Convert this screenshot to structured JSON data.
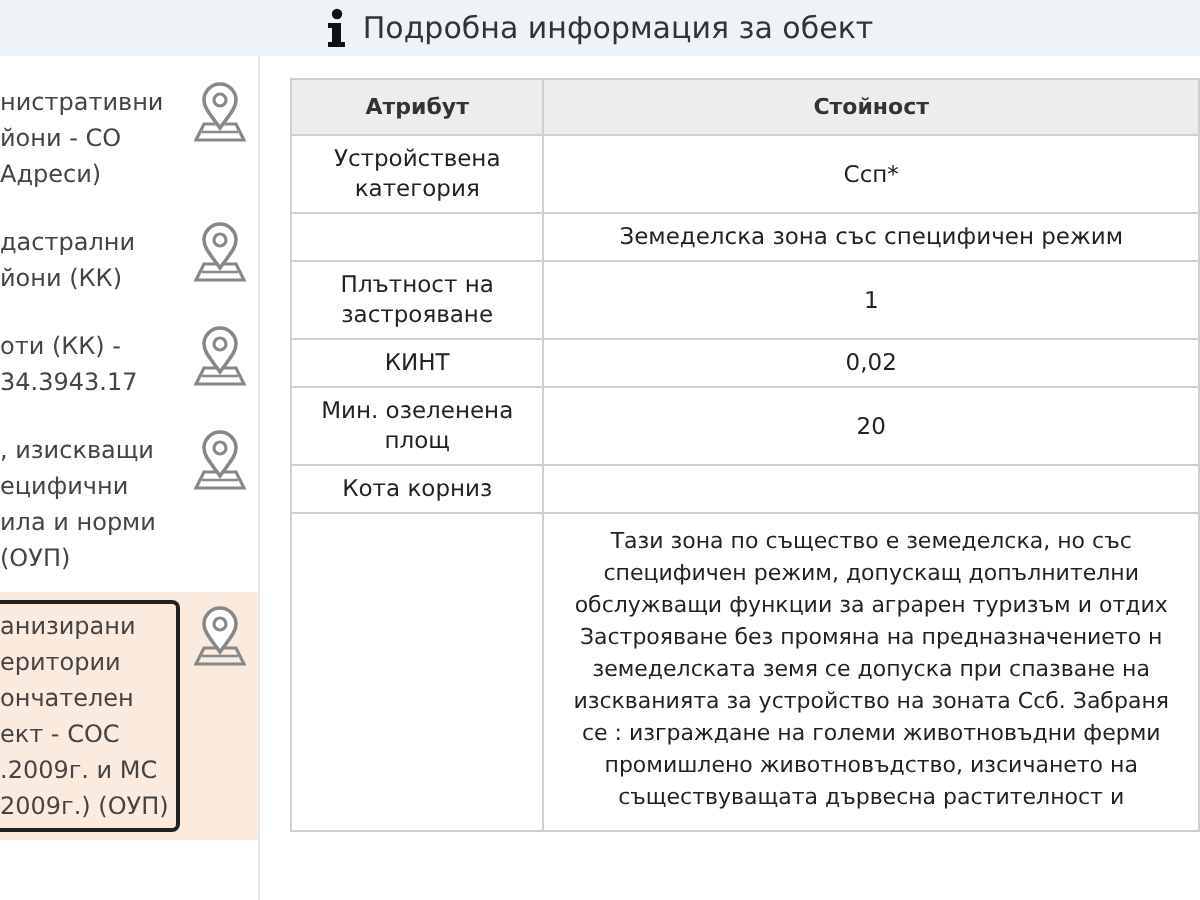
{
  "header": {
    "title": "Подробна информация за обект"
  },
  "layers": [
    {
      "text": "нистративни\nйони - СО\nАдреси)",
      "selected": false
    },
    {
      "text": "дастрални\nйони (КК)",
      "selected": false
    },
    {
      "text": "оти (КК) -\n34.3943.17",
      "selected": false
    },
    {
      "text": ", изискващи\nецифични\nила и норми\n(ОУП)",
      "selected": false
    },
    {
      "text": "анизирани\nеритории\nончателен\nект - СОС\n.2009г. и МС\n2009г.) (ОУП)",
      "selected": true
    }
  ],
  "table": {
    "columns": [
      "Атрибут",
      "Стойност"
    ],
    "rows": [
      {
        "attribute": "Устройствена категория",
        "value": "Ссп*"
      },
      {
        "value": "Земеделска зона със специфичен режим"
      },
      {
        "attribute": "Плътност на застрояване",
        "value": "1"
      },
      {
        "attribute": "КИНТ",
        "value": "0,02"
      },
      {
        "attribute": "Мин. озеленена площ",
        "value": "20"
      },
      {
        "attribute": "Кота корниз"
      },
      {
        "value": "Тази зона по същество е земеделска, но със\nспецифичен режим, допускащ допълнителни\nобслужващи функции за аграрен туризъм и отдих\nЗастрояване без промяна на предназначението н\nземеделската земя се допуска при спазване на\nизскванията за устройство на зоната Ссб. Забраня\nсе : изграждане на големи животновъдни ферми\nпромишлено животновъдство, изсичането на\nсъществуващата дървесна растителност и",
        "kind": "long"
      }
    ]
  }
}
